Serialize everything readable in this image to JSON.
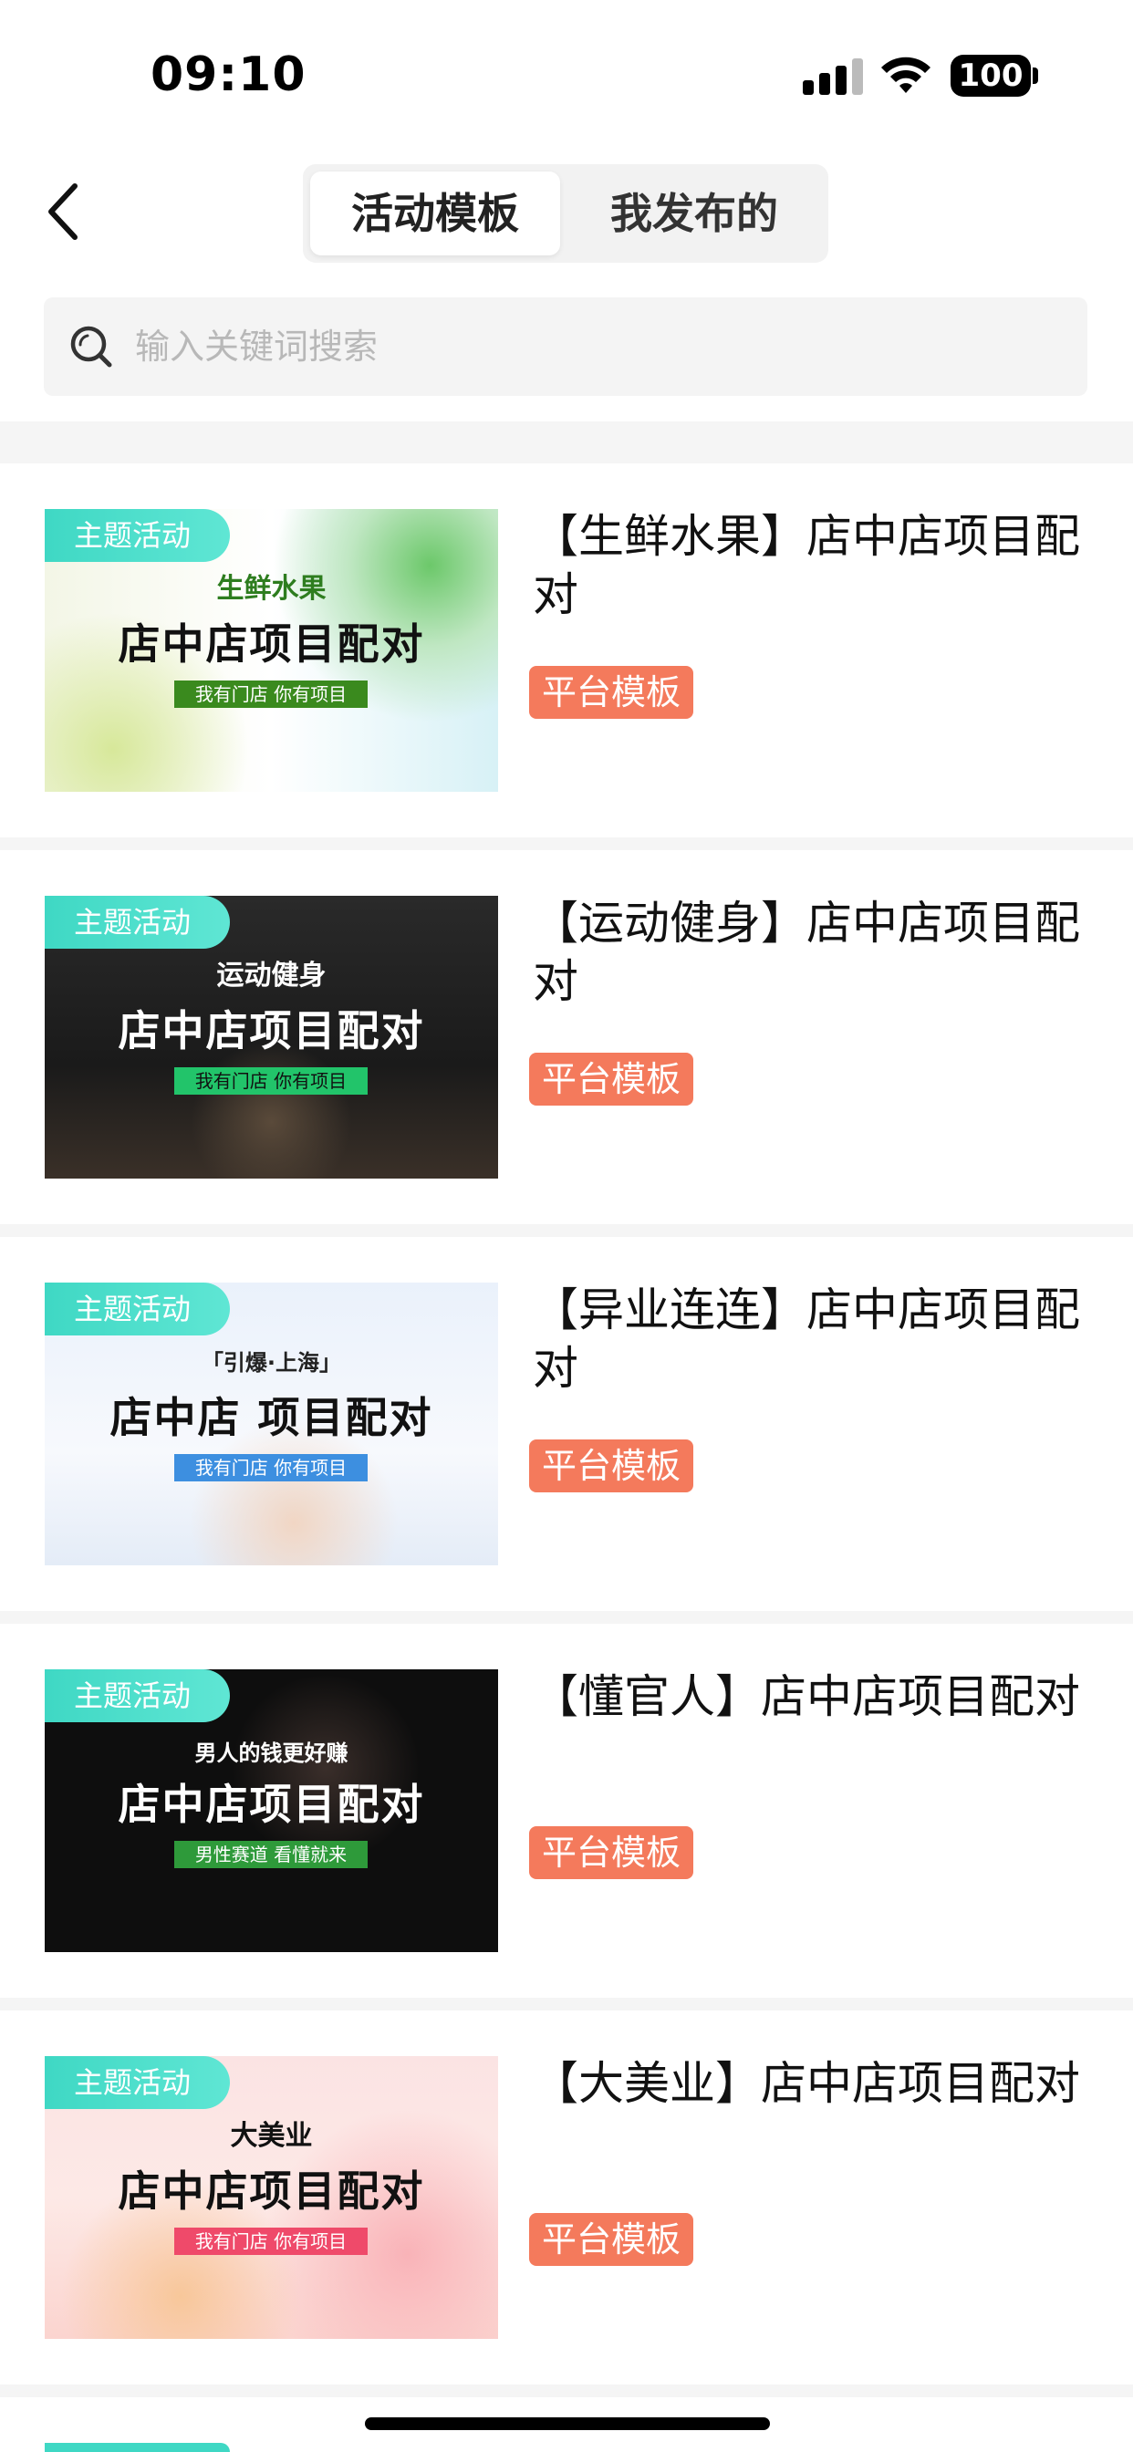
{
  "status_bar": {
    "time": "09:10",
    "battery": "100"
  },
  "nav": {
    "tabs": [
      {
        "label": "活动模板",
        "active": true
      },
      {
        "label": "我发布的",
        "active": false
      }
    ]
  },
  "search": {
    "placeholder": "输入关键词搜索",
    "value": ""
  },
  "cards": [
    {
      "badge": "主题活动",
      "image_sub": "生鲜水果",
      "image_headline": "店中店项目配对",
      "image_pill": "我有门店 你有项目",
      "title": "【生鲜水果】店中店项目配对",
      "tag": "平台模板"
    },
    {
      "badge": "主题活动",
      "image_sub": "运动健身",
      "image_headline": "店中店项目配对",
      "image_pill": "我有门店 你有项目",
      "title": "【运动健身】店中店项目配对",
      "tag": "平台模板"
    },
    {
      "badge": "主题活动",
      "image_sub": "「引爆·上海」",
      "image_headline": "店中店 项目配对",
      "image_pill": "我有门店 你有项目",
      "title": "【异业连连】店中店项目配对",
      "tag": "平台模板"
    },
    {
      "badge": "主题活动",
      "image_sub": "男人的钱更好赚",
      "image_headline": "店中店项目配对",
      "image_pill": "男性赛道 看懂就来",
      "title": "【懂官人】店中店项目配对",
      "tag": "平台模板"
    },
    {
      "badge": "主题活动",
      "image_sub": "大美业",
      "image_headline": "店中店项目配对",
      "image_pill": "我有门店 你有项目",
      "title": "【大美业】店中店项目配对",
      "tag": "平台模板"
    }
  ],
  "colors": {
    "tag_bg": "#f47a5c",
    "badge_bg": "#3fd8c4",
    "search_bg": "#f4f4f4"
  }
}
